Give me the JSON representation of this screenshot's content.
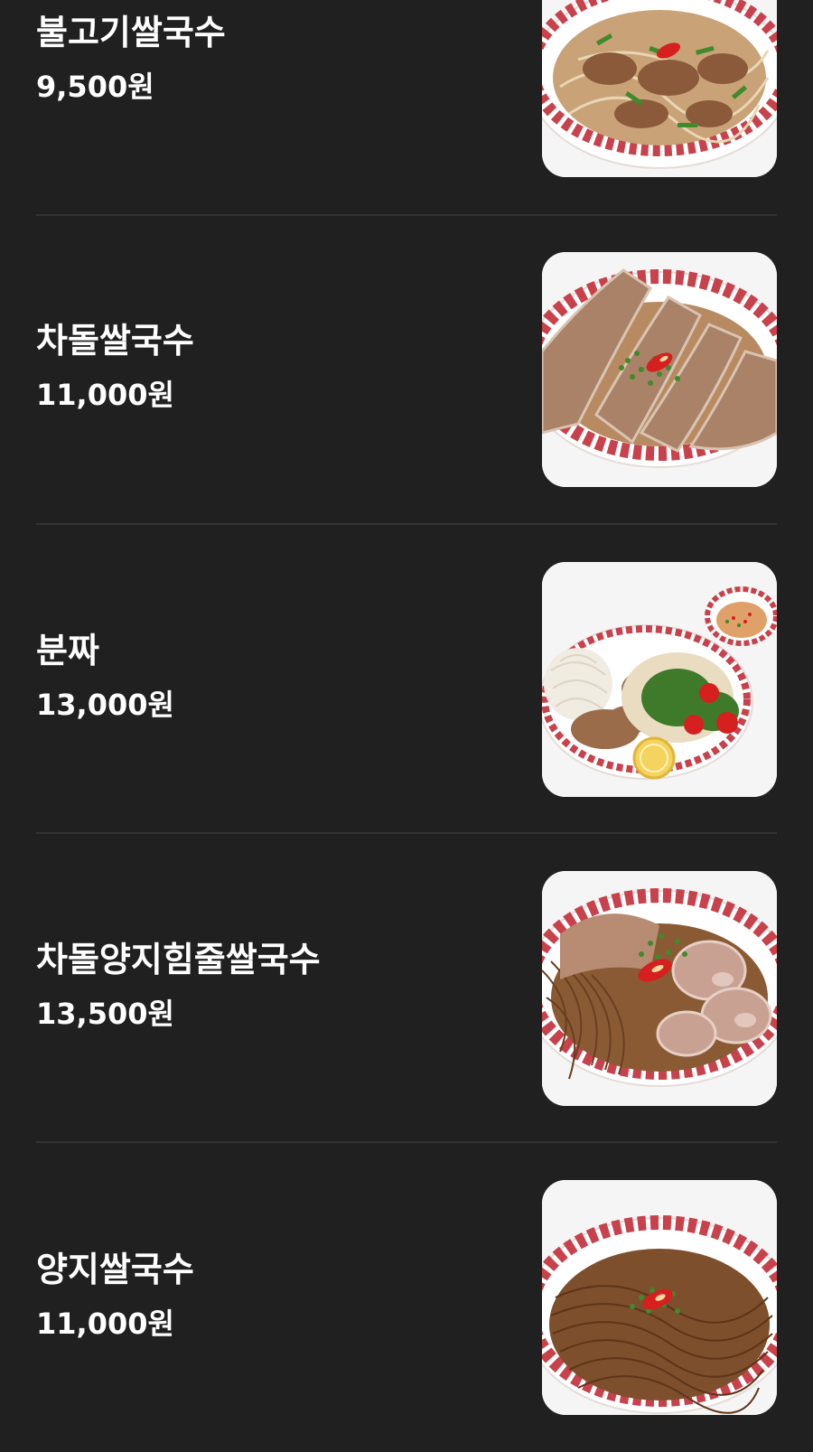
{
  "menu": {
    "items": [
      {
        "name": "불고기쌀국수",
        "price": "9,500원",
        "photo_icon": "bulgogi-pho-photo"
      },
      {
        "name": "차돌쌀국수",
        "price": "11,000원",
        "photo_icon": "chadol-pho-photo"
      },
      {
        "name": "분짜",
        "price": "13,000원",
        "photo_icon": "bun-cha-photo"
      },
      {
        "name": "차돌양지힘줄쌀국수",
        "price": "13,500원",
        "photo_icon": "chadol-yangji-tendon-pho-photo"
      },
      {
        "name": "양지쌀국수",
        "price": "11,000원",
        "photo_icon": "yangji-pho-photo"
      }
    ]
  },
  "colors": {
    "background": "#202020",
    "divider": "#333333",
    "text": "#ffffff",
    "bowl_rim_pattern": "#c8414b",
    "chili": "#d61f1f",
    "scallion": "#3f8a2a"
  }
}
